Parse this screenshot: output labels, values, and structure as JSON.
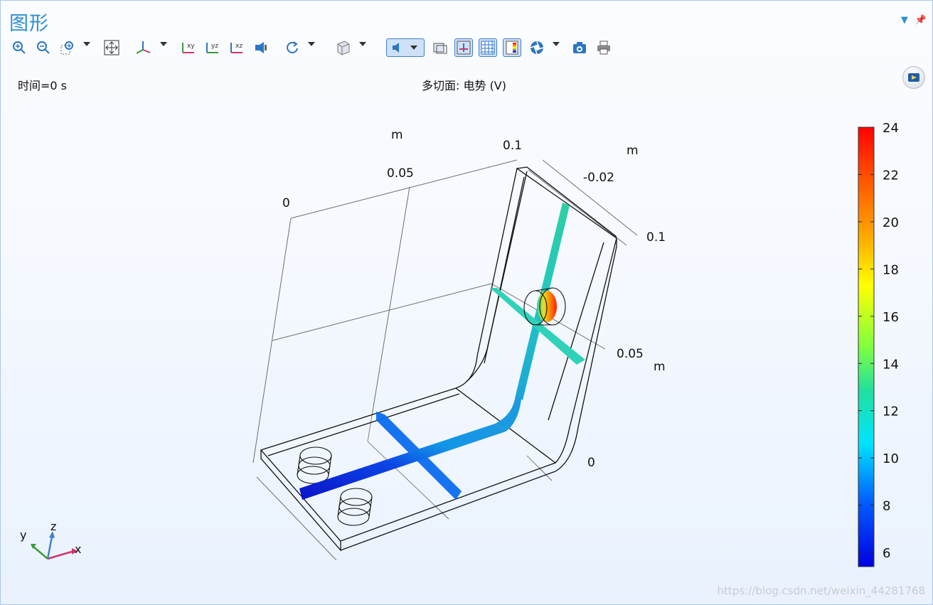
{
  "window": {
    "title": "图形",
    "menu_icon": "dropdown-arrow-icon",
    "pin_icon": "pin-icon"
  },
  "toolbar": {
    "icons": [
      "zoom-in-icon",
      "zoom-out-icon",
      "zoom-box-icon",
      "zoom-extents-icon",
      "axis-view-icon",
      "xy-view-icon",
      "yz-view-icon",
      "xz-view-icon",
      "light-icon",
      "rotate-icon",
      "render-icon",
      "wireframe-icon",
      "grid-icon",
      "legend-icon",
      "scene-light-icon",
      "camera-icon",
      "print-icon"
    ]
  },
  "plot": {
    "time_label": "时间=0 s",
    "title": "多切面: 电势 (V)"
  },
  "axes": {
    "labels": {
      "m_top": "m",
      "m_right": "m",
      "m_bottom_right": "m",
      "t_0": "0",
      "t_005": "0.05",
      "t_01": "0.1",
      "t_neg002": "-0.02",
      "t_01b": "0.1",
      "t_005b": "0.05",
      "t_0b": "0"
    }
  },
  "colorbar": {
    "ticks": [
      "24",
      "22",
      "20",
      "18",
      "16",
      "14",
      "12",
      "10",
      "8",
      "6"
    ],
    "min": 5.4,
    "max": 24
  },
  "triad": {
    "x": "x",
    "y": "y",
    "z": "z"
  },
  "colors": {
    "accent": "#2e8fd4",
    "slice_low": "#0b1fd6",
    "slice_mid": "#0a7bff",
    "slice_teal": "#28d3b4",
    "hot": "#ff2000"
  },
  "watermark": "https://blog.csdn.net/weixin_44281768"
}
